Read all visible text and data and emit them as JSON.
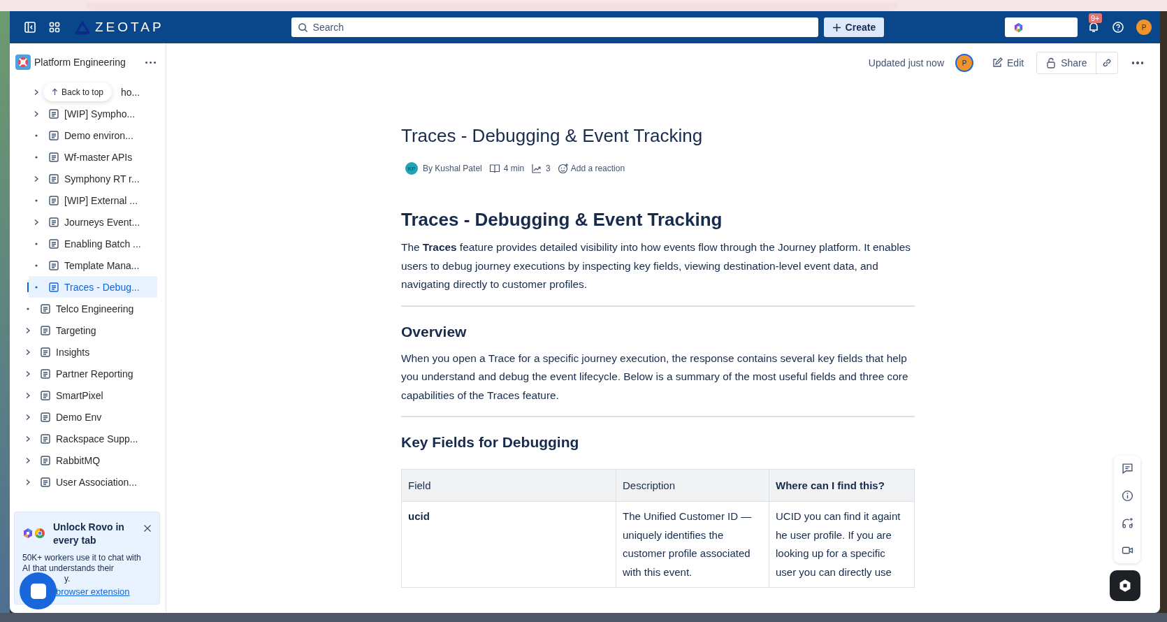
{
  "header": {
    "logo": "ZEOTAP",
    "search": {
      "placeholder": "Search"
    },
    "create_button": "Create",
    "notifications_badge": "9+",
    "avatar": "P"
  },
  "space": {
    "name": "Platform Engineering"
  },
  "back_to_top": "Back to top",
  "sidebar": {
    "child_items": [
      {
        "label": "ho...",
        "kind": "chevron",
        "selected": false
      },
      {
        "label": "[WIP] Sympho...",
        "kind": "chevron",
        "selected": false
      },
      {
        "label": "Demo environ...",
        "kind": "bullet",
        "selected": false
      },
      {
        "label": "Wf-master APIs",
        "kind": "bullet",
        "selected": false
      },
      {
        "label": "Symphony RT r...",
        "kind": "chevron",
        "selected": false
      },
      {
        "label": "[WIP] External ...",
        "kind": "bullet",
        "selected": false
      },
      {
        "label": "Journeys Event...",
        "kind": "chevron",
        "selected": false
      },
      {
        "label": "Enabling Batch ...",
        "kind": "bullet",
        "selected": false
      },
      {
        "label": "Template Mana...",
        "kind": "bullet",
        "selected": false
      },
      {
        "label": "Traces - Debug...",
        "kind": "bullet",
        "selected": true
      }
    ],
    "items": [
      {
        "label": "Telco Engineering",
        "kind": "bullet",
        "selected": false
      },
      {
        "label": "Targeting",
        "kind": "chevron",
        "selected": false
      },
      {
        "label": "Insights",
        "kind": "chevron",
        "selected": false
      },
      {
        "label": "Partner Reporting",
        "kind": "chevron",
        "selected": false
      },
      {
        "label": "SmartPixel",
        "kind": "chevron",
        "selected": false
      },
      {
        "label": "Demo Env",
        "kind": "chevron",
        "selected": false
      },
      {
        "label": "Rackspace Supp...",
        "kind": "chevron",
        "selected": false
      },
      {
        "label": "RabbitMQ",
        "kind": "chevron",
        "selected": false
      },
      {
        "label": "User Association...",
        "kind": "chevron",
        "selected": false
      }
    ]
  },
  "promo": {
    "title": "Unlock Rovo in every tab",
    "description": "50K+ workers use it to chat with AI that understands their",
    "description_tail": "y.",
    "link": "browser extension"
  },
  "page_toolbar": {
    "status": "Updated just now",
    "avatar": "P",
    "edit": "Edit",
    "share": "Share"
  },
  "page": {
    "title": "Traces - Debugging & Event Tracking",
    "byline": {
      "initials": "KP",
      "author": "By Kushal Patel",
      "read_time": "4 min",
      "views": "3",
      "reaction": "Add a reaction"
    },
    "blocks": [
      {
        "kind": "h1",
        "text": "Traces - Debugging & Event Tracking"
      },
      {
        "kind": "p",
        "text": "The **Traces** feature provides detailed visibility into how events flow through the Journey platform. It enables users to debug journey executions by inspecting key fields, viewing destination-level event data, and navigating directly to customer profiles."
      },
      {
        "kind": "hr"
      },
      {
        "kind": "h2",
        "text": "Overview"
      },
      {
        "kind": "p",
        "text": "When you open a Trace for a specific journey execution, the response contains several key fields that help you understand and debug the event lifecycle. Below is a summary of the most useful fields and three core capabilities of the Traces feature."
      },
      {
        "kind": "hr"
      },
      {
        "kind": "h2",
        "text": "Key Fields for Debugging"
      },
      {
        "kind": "table",
        "columns": [
          {
            "label": "Field",
            "bold": false
          },
          {
            "label": "Description",
            "bold": false
          },
          {
            "label": "Where can I find this?",
            "bold": true
          }
        ],
        "rows": [
          [
            {
              "text": "ucid",
              "bold": true
            },
            {
              "text": "The Unified Customer ID — uniquely identifies the customer profile associated with this event.",
              "bold": false
            },
            {
              "text": "UCID you can find it againt he user profile. If you are looking up for a specific user you can directly use",
              "bold": false
            }
          ]
        ]
      }
    ]
  }
}
